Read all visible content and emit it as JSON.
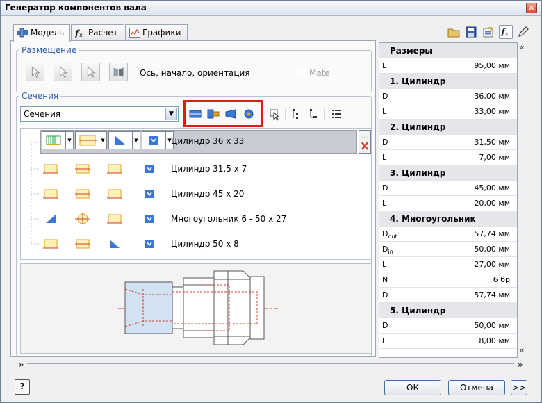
{
  "window": {
    "title": "Генератор компонентов вала"
  },
  "tabs": [
    {
      "label": "Модель",
      "icon": "shaft-model-icon"
    },
    {
      "label": "Расчет",
      "icon": "fx-calc-icon"
    },
    {
      "label": "Графики",
      "icon": "graph-icon"
    }
  ],
  "placement": {
    "legend": "Размещение",
    "buttons": [
      "select-cylinder-icon",
      "select-start-icon",
      "select-end-icon",
      "flip-icon"
    ],
    "label": "Ось, начало, ориентация",
    "mate_label": "Mate",
    "mate_checked": false
  },
  "sections": {
    "legend": "Сечения",
    "dropdown_value": "Сечения",
    "rows": [
      {
        "label": "Цилиндр 36 x 33",
        "selected": true
      },
      {
        "label": "Цилиндр 31,5 x 7"
      },
      {
        "label": "Цилиндр 45 x 20"
      },
      {
        "label": "Многоугольник 6 - 50 x 27"
      },
      {
        "label": "Цилиндр 50 x 8"
      }
    ]
  },
  "properties": {
    "header": "Размеры",
    "rows": [
      {
        "kind": "prop",
        "name": "L",
        "value": "95,00 мм"
      },
      {
        "kind": "head",
        "name": "1. Цилиндр"
      },
      {
        "kind": "prop",
        "name": "D",
        "value": "36,00 мм"
      },
      {
        "kind": "prop",
        "name": "L",
        "value": "33,00 мм"
      },
      {
        "kind": "head",
        "name": "2. Цилиндр"
      },
      {
        "kind": "prop",
        "name": "D",
        "value": "31,50 мм"
      },
      {
        "kind": "prop",
        "name": "L",
        "value": "7,00 мм"
      },
      {
        "kind": "head",
        "name": "3. Цилиндр"
      },
      {
        "kind": "prop",
        "name": "D",
        "value": "45,00 мм"
      },
      {
        "kind": "prop",
        "name": "L",
        "value": "20,00 мм"
      },
      {
        "kind": "head",
        "name": "4. Многоугольник"
      },
      {
        "kind": "prop",
        "name": "D",
        "sub": "out",
        "value": "57,74 мм"
      },
      {
        "kind": "prop",
        "name": "D",
        "sub": "in",
        "value": "50,00 мм"
      },
      {
        "kind": "prop",
        "name": "L",
        "value": "27,00 мм"
      },
      {
        "kind": "prop",
        "name": "N",
        "value": "6 бр"
      },
      {
        "kind": "prop",
        "name": "D",
        "value": "57,74 мм"
      },
      {
        "kind": "head",
        "name": "5. Цилиндр"
      },
      {
        "kind": "prop",
        "name": "D",
        "value": "50,00 мм"
      },
      {
        "kind": "prop",
        "name": "L",
        "value": "8,00 мм"
      }
    ]
  },
  "footer": {
    "help": "?",
    "ok": "ОК",
    "cancel": "Отмена",
    "more": ">>"
  },
  "collapse": {
    "up": "«",
    "down": "»"
  },
  "colors": {
    "highlight": "#e01919",
    "accent_blue": "#2a5aa8",
    "selection": "#c8cbd2"
  }
}
